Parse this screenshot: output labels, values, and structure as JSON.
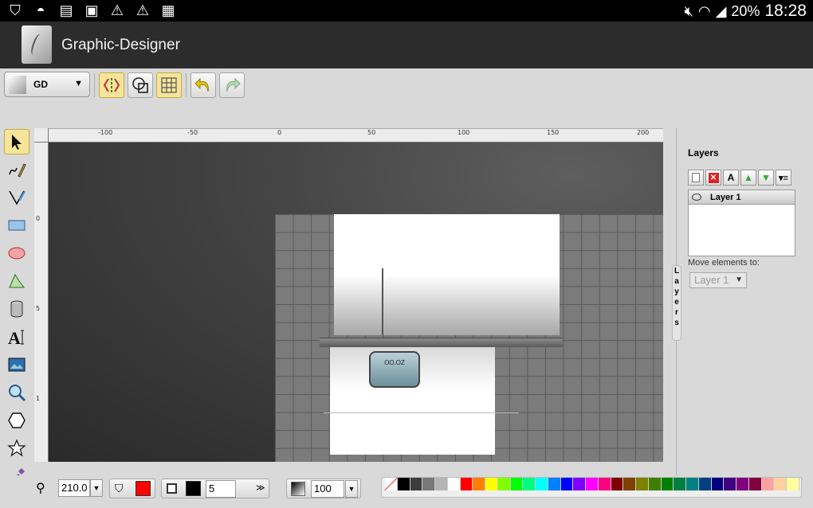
{
  "status_bar": {
    "left_icons": [
      "shield-icon",
      "mask-icon",
      "document-icon",
      "image-icon",
      "warning-icon",
      "warning-icon",
      "clipboard-icon"
    ],
    "battery": "20%",
    "time": "18:28"
  },
  "app": {
    "title": "Graphic-Designer"
  },
  "toolbar": {
    "document_label": "GD",
    "buttons": [
      "snap-icon",
      "shapes-icon",
      "grid-icon",
      "undo-icon",
      "redo-icon"
    ]
  },
  "tools": [
    "select-icon",
    "freehand-icon",
    "pen-icon",
    "rectangle-icon",
    "ellipse-icon",
    "polygon-icon",
    "cylinder-icon",
    "text-icon",
    "image-icon",
    "zoom-icon",
    "hexagon-icon",
    "star-icon",
    "eyedropper-icon"
  ],
  "ruler": {
    "top_labels": [
      "-100",
      "-50",
      "0",
      "50",
      "100",
      "150",
      "200"
    ],
    "left_labels": [
      "0",
      "5",
      "1"
    ]
  },
  "canvas": {
    "scale_text": "OO.OZ"
  },
  "layers_panel": {
    "title": "Layers",
    "tool_labels": [
      "A"
    ],
    "layers": [
      "Layer 1"
    ],
    "move_label": "Move elements to:",
    "move_value": "Layer 1",
    "side_tab": "Layers"
  },
  "bottom": {
    "zoom": "210.0",
    "stroke_width": "5",
    "opacity": "100",
    "fill_color": "#ff0000",
    "stroke_color": "#000000"
  },
  "palette": [
    "#000000",
    "#3c3c3c",
    "#787878",
    "#b4b4b4",
    "#ffffff",
    "#ff0000",
    "#ff8000",
    "#ffff00",
    "#80ff00",
    "#00ff00",
    "#00ff80",
    "#00ffff",
    "#0080ff",
    "#0000ff",
    "#8000ff",
    "#ff00ff",
    "#ff0080",
    "#800000",
    "#804000",
    "#808000",
    "#408000",
    "#008000",
    "#008040",
    "#008080",
    "#004080",
    "#000080",
    "#400080",
    "#800080",
    "#800040",
    "#ffa0a0",
    "#ffd0a0",
    "#ffffa0"
  ]
}
